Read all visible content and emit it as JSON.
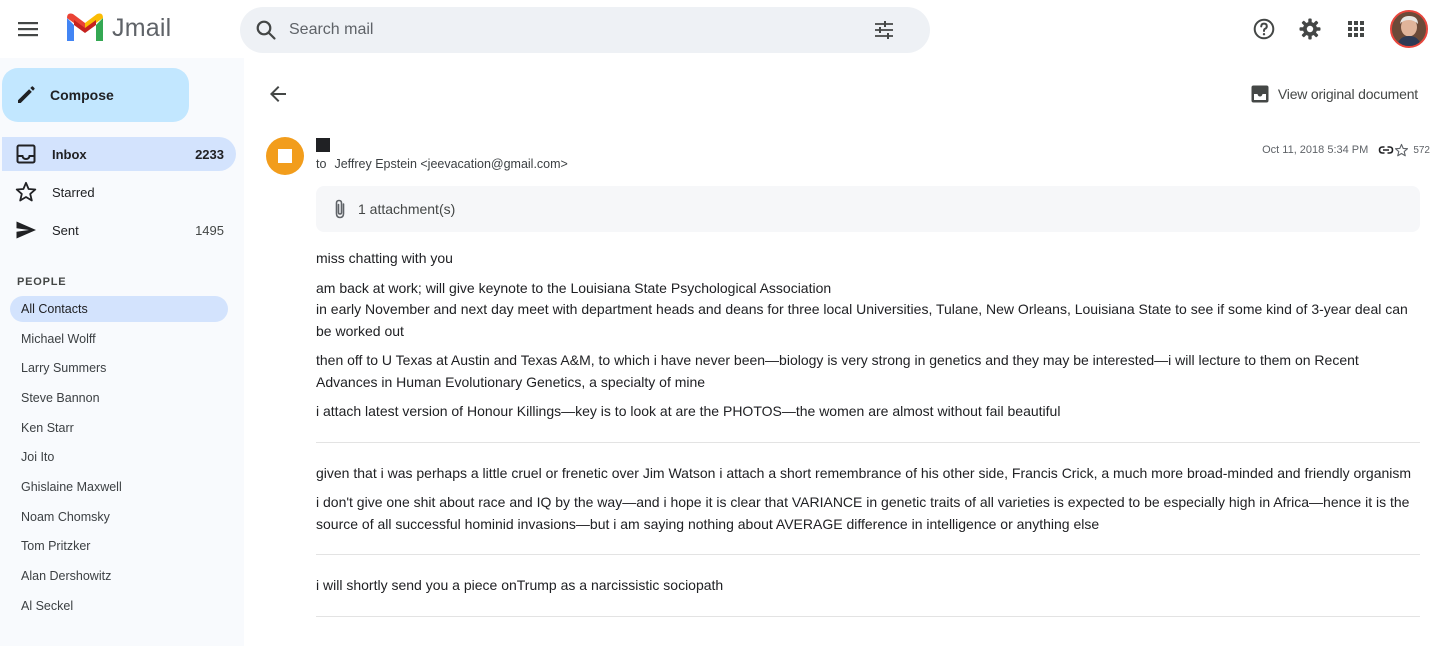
{
  "app": {
    "logo_text": "Jmail",
    "brand_colors": {
      "red": "#ea4335",
      "blue": "#4285f4",
      "green": "#34a853",
      "yellow": "#fbbc04"
    }
  },
  "header": {
    "search_placeholder": "Search mail",
    "icons": [
      "menu-icon",
      "search-icon",
      "tune-icon",
      "help-icon",
      "gear-icon",
      "apps-icon",
      "avatar"
    ]
  },
  "sidebar": {
    "compose_label": "Compose",
    "nav": [
      {
        "label": "Inbox",
        "count": "2233",
        "icon": "inbox-icon",
        "active": true
      },
      {
        "label": "Starred",
        "count": "",
        "icon": "star-icon",
        "active": false
      },
      {
        "label": "Sent",
        "count": "1495",
        "icon": "send-icon",
        "active": false
      }
    ],
    "people_heading": "PEOPLE",
    "contacts": [
      "All Contacts",
      "Michael Wolff",
      "Larry Summers",
      "Steve Bannon",
      "Ken Starr",
      "Joi Ito",
      "Ghislaine Maxwell",
      "Noam Chomsky",
      "Tom Pritzker",
      "Alan Dershowitz",
      "Al Seckel"
    ]
  },
  "message": {
    "view_original_label": "View original document",
    "to_label": "to",
    "recipient": "Jeffrey Epstein <jeevacation@gmail.com>",
    "date": "Oct 11, 2018 5:34 PM",
    "star_count": "572",
    "attachment_label": "1 attachment(s)",
    "sender_avatar_color": "#f29d1c",
    "body": [
      "miss chatting with you",
      "am back at work; will give keynote to the Louisiana State Psychological Association",
      "in early November and next day meet with department heads and deans for three local Universities, Tulane, New Orleans, Louisiana State to see if some kind of 3-year deal can be worked out",
      "then off to U Texas at Austin and Texas A&M, to which i have never been—biology is very strong in genetics and they may be interested—i will lecture to them on Recent Advances in Human Evolutionary Genetics, a specialty of mine",
      "i attach latest version of Honour Killings—key is to look at are the PHOTOS—the women are almost without fail beautiful",
      "given that i was perhaps a little cruel or frenetic over Jim Watson i attach a short remembrance of his other side, Francis Crick, a much more broad-minded and friendly organism",
      "i don't give one shit about race and IQ by the way—and i hope it is clear that VARIANCE in genetic traits of all varieties is expected to be especially high in Africa—hence it is the source of all successful hominid invasions—but i am saying nothing about AVERAGE difference in intelligence or anything else",
      "i will shortly send you a piece onTrump as a narcissistic sociopath"
    ]
  }
}
